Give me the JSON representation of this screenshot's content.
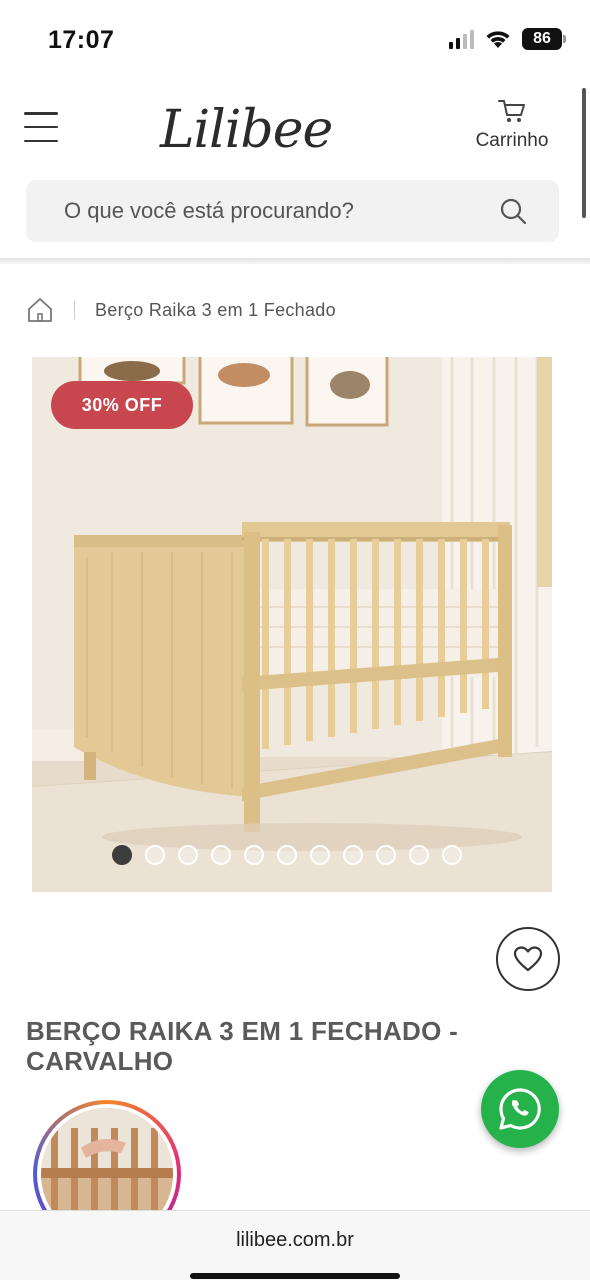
{
  "status_bar": {
    "time": "17:07",
    "battery": "86"
  },
  "header": {
    "logo_text": "Lilibee",
    "cart_label": "Carrinho",
    "menu_icon": "hamburger-menu-icon",
    "cart_icon": "shopping-cart-icon"
  },
  "search": {
    "placeholder": "O que você está procurando?",
    "icon": "search-icon"
  },
  "breadcrumb": {
    "home_icon": "home-icon",
    "current": "Berço Raika 3 em 1 Fechado"
  },
  "product": {
    "discount_badge": "30% OFF",
    "title": "BERÇO RAIKA 3 EM 1 FECHADO - CARVALHO",
    "image_count": 11,
    "active_image": 1
  },
  "browser": {
    "url": "lilibee.com.br"
  },
  "colors": {
    "badge": "#c8474f",
    "whatsapp": "#25b24a",
    "search_bg": "#f2f2f2"
  }
}
